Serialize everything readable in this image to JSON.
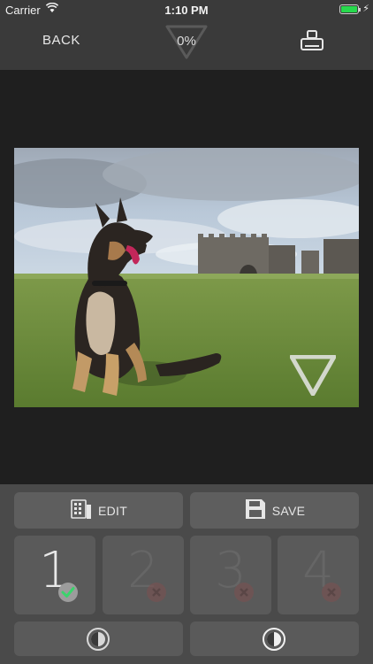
{
  "status_bar": {
    "carrier": "Carrier",
    "time": "1:10 PM",
    "battery_color": "#27d94d"
  },
  "nav": {
    "back_label": "BACK",
    "progress_text": "0%",
    "right_icon": "stamp-icon"
  },
  "photo": {
    "subject": "german-shepherd-dog-photo",
    "watermark_icon": "triangle-watermark-icon"
  },
  "actions": {
    "edit_label": "EDIT",
    "edit_icon": "edit-grid-icon",
    "save_label": "SAVE",
    "save_icon": "floppy-disk-icon"
  },
  "slots": [
    {
      "label": "1",
      "status": "done",
      "status_icon": "check-icon"
    },
    {
      "label": "2",
      "status": "empty",
      "status_icon": "x-icon"
    },
    {
      "label": "3",
      "status": "empty",
      "status_icon": "x-icon"
    },
    {
      "label": "4",
      "status": "empty",
      "status_icon": "x-icon"
    }
  ],
  "toggles": [
    {
      "icon": "contrast-circle-icon"
    },
    {
      "icon": "contrast-circle-icon"
    }
  ],
  "colors": {
    "panel_bg": "#4a4a4a",
    "button_bg": "#5e5e5e",
    "check_green": "#3ad46b"
  }
}
